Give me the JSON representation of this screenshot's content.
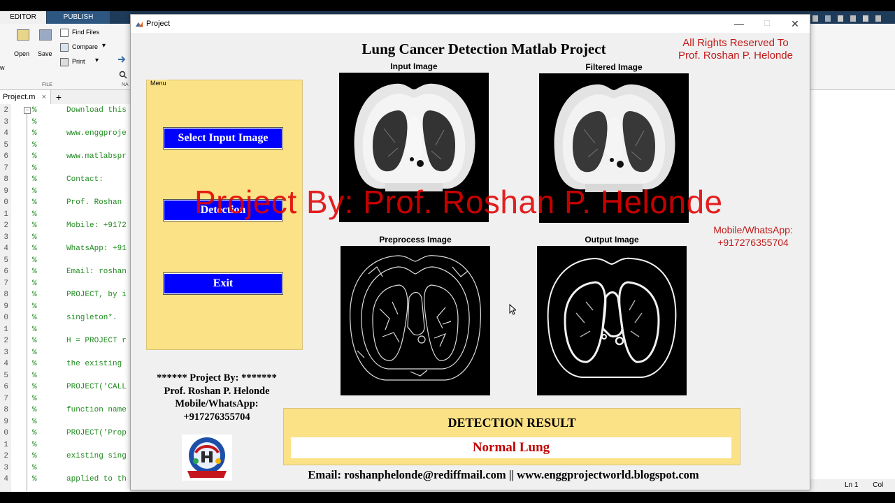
{
  "matlab": {
    "tabs": [
      "EDITOR",
      "PUBLISH"
    ],
    "ribbon": {
      "open_label": "Open",
      "save_label": "Save",
      "new_label": "w",
      "find_files_label": "Find Files",
      "compare_label": "Compare",
      "print_label": "Print",
      "section_file": "FILE",
      "section_na": "NA"
    },
    "file_tab": "Project.m",
    "plus_tab": "+",
    "code_lines": [
      {
        "num": "2",
        "text": "Download this"
      },
      {
        "num": "3",
        "text": ""
      },
      {
        "num": "4",
        "text": "www.enggproje"
      },
      {
        "num": "5",
        "text": ""
      },
      {
        "num": "6",
        "text": "www.matlabspr"
      },
      {
        "num": "7",
        "text": ""
      },
      {
        "num": "8",
        "text": "Contact:"
      },
      {
        "num": "9",
        "text": ""
      },
      {
        "num": "0",
        "text": "Prof. Roshan"
      },
      {
        "num": "1",
        "text": ""
      },
      {
        "num": "2",
        "text": "Mobile: +9172"
      },
      {
        "num": "3",
        "text": ""
      },
      {
        "num": "4",
        "text": "WhatsApp: +91"
      },
      {
        "num": "5",
        "text": ""
      },
      {
        "num": "6",
        "text": "Email: roshan"
      },
      {
        "num": "7",
        "text": ""
      },
      {
        "num": "8",
        "text": "PROJECT, by i"
      },
      {
        "num": "9",
        "text": ""
      },
      {
        "num": "0",
        "text": "singleton*."
      },
      {
        "num": "1",
        "text": ""
      },
      {
        "num": "2",
        "text": "H = PROJECT r"
      },
      {
        "num": "3",
        "text": ""
      },
      {
        "num": "4",
        "text": "the existing"
      },
      {
        "num": "5",
        "text": ""
      },
      {
        "num": "6",
        "text": "PROJECT('CALL"
      },
      {
        "num": "7",
        "text": ""
      },
      {
        "num": "8",
        "text": "function name"
      },
      {
        "num": "9",
        "text": ""
      },
      {
        "num": "0",
        "text": "PROJECT('Prop"
      },
      {
        "num": "1",
        "text": ""
      },
      {
        "num": "2",
        "text": "existing sing"
      },
      {
        "num": "3",
        "text": ""
      },
      {
        "num": "4",
        "text": "applied to th"
      }
    ],
    "comment_char": "%",
    "status_ln": "Ln  1",
    "status_col": "Col"
  },
  "window": {
    "title": "Project",
    "minimize": "—",
    "maximize": "☐",
    "close": "✕"
  },
  "app": {
    "title": "Lung Cancer Detection Matlab Project",
    "rights_line1": "All Rights Reserved To",
    "rights_line2": "Prof. Roshan P. Helonde",
    "contact_line1": "Mobile/WhatsApp:",
    "contact_line2": "+917276355704",
    "images": {
      "input": "Input Image",
      "filtered": "Filtered Image",
      "preprocess": "Preprocess Image",
      "output": "Output Image"
    },
    "menu": {
      "label": "Menu",
      "select_button": "Select Input Image",
      "detection_button": "Detection",
      "exit_button": "Exit"
    },
    "credits": {
      "line1": "****** Project By: *******",
      "line2": "Prof. Roshan P. Helonde",
      "line3": "Mobile/WhatsApp:",
      "line4": "+917276355704"
    },
    "result": {
      "heading": "DETECTION RESULT",
      "value": "Normal Lung"
    },
    "footer": "Email: roshanphelonde@rediffmail.com ||   www.enggprojectworld.blogspot.com",
    "watermark": "Project By: Prof. Roshan P. Helonde"
  },
  "colors": {
    "panel_yellow": "#fbe287",
    "button_blue": "#0000ff",
    "accent_red": "#c21a1a",
    "result_red": "#c00000"
  }
}
